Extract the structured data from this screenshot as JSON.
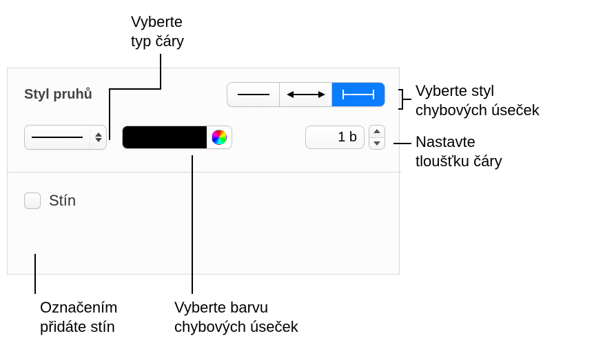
{
  "panel": {
    "section_title": "Styl pruhů",
    "thickness_value": "1 b",
    "shadow_label": "Stín",
    "color_value": "#000000"
  },
  "callouts": {
    "line_type": "Vyberte\ntyp čáry",
    "error_bar_style": "Vyberte styl\nchybových úseček",
    "thickness": "Nastavte\ntloušťku čáry",
    "shadow": "Označením\npřidáte stín",
    "color": "Vyberte barvu\nchybových úseček"
  }
}
